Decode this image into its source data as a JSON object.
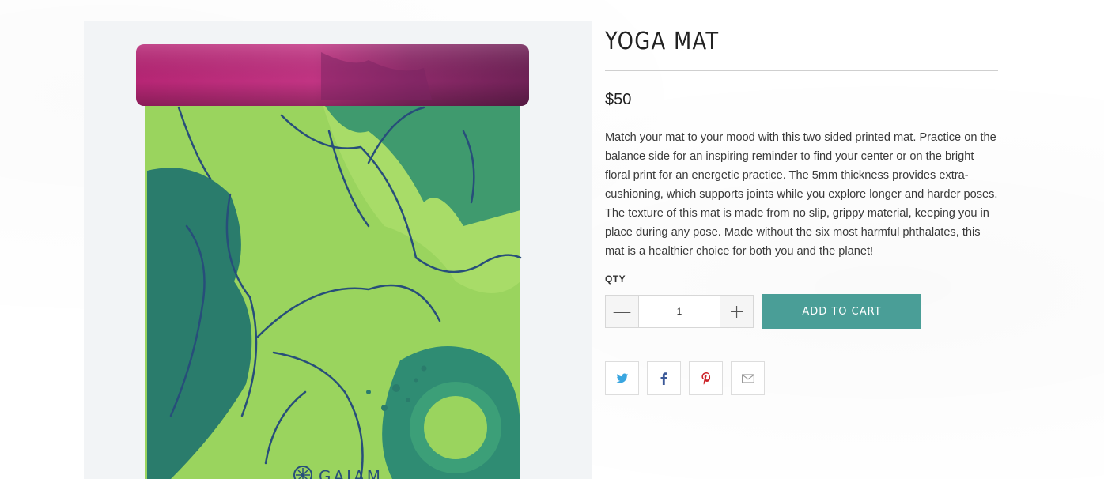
{
  "product": {
    "title": "YOGA MAT",
    "price": "$50",
    "description": "Match your mat to your mood with this two sided printed mat. Practice on the balance side for an inspiring reminder to find your center or on the bright floral print for an energetic practice. The 5mm thickness provides extra-cushioning, which supports joints while you explore longer and harder poses. The texture of this mat is made from no slip, grippy material, keeping you in place during any pose. Made without the six most harmful phthalates, this mat is a healthier choice for both you and the planet!",
    "brand_mark": "GAIAM"
  },
  "purchase": {
    "qty_label": "QTY",
    "qty_value": "1",
    "minus_symbol": "—",
    "plus_symbol": "+",
    "add_to_cart_label": "ADD TO CART"
  },
  "share": {
    "buttons": [
      {
        "icon": "twitter-icon",
        "color": "#3aa6e0"
      },
      {
        "icon": "facebook-icon",
        "color": "#3b5998"
      },
      {
        "icon": "pinterest-icon",
        "color": "#cc2127"
      },
      {
        "icon": "email-icon",
        "color": "#999999"
      }
    ]
  },
  "colors": {
    "accent": "#4a9e97",
    "mat_roll": "#a8266a",
    "mat_green": "#9ad45e",
    "leaf_dark": "#2a7c6c"
  }
}
